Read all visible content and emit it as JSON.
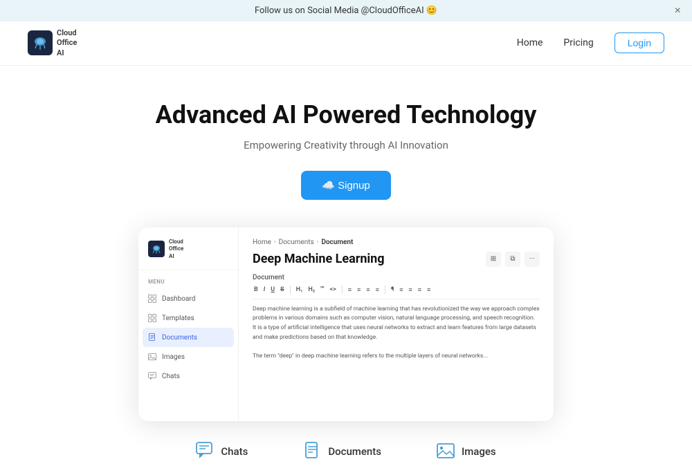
{
  "announcement": {
    "text": "Follow us on Social Media @CloudOfficeAI 😊",
    "close_label": "×"
  },
  "navbar": {
    "logo_name": "Cloud Office AI",
    "nav_home": "Home",
    "nav_pricing": "Pricing",
    "login_label": "Login"
  },
  "hero": {
    "title": "Advanced AI Powered Technology",
    "subtitle": "Empowering Creativity through AI Innovation",
    "signup_label": "☁️ Signup"
  },
  "preview": {
    "sidebar": {
      "logo": "Cloud Office AI",
      "menu_label": "MENU",
      "items": [
        {
          "label": "Dashboard",
          "active": false
        },
        {
          "label": "Templates",
          "active": false
        },
        {
          "label": "Documents",
          "active": true
        },
        {
          "label": "Images",
          "active": false
        },
        {
          "label": "Chats",
          "active": false
        }
      ]
    },
    "main": {
      "breadcrumb": [
        "Home",
        "Documents",
        "Document"
      ],
      "doc_title": "Deep Machine Learning",
      "document_label": "Document",
      "toolbar_items": [
        "B",
        "I",
        "U",
        "S",
        "H₁",
        "H₂",
        "\"\"",
        "<>",
        "≡",
        "≡",
        "≡",
        "≡",
        "¶",
        "≡",
        "≡",
        "≡",
        "≡"
      ],
      "content_para1": "Deep machine learning is a subfield of machine learning that has revolutionized the way we approach complex problems in various domains such as computer vision, natural language processing, and speech recognition. It is a type of artificial intelligence that uses neural networks to extract and learn features from large datasets and make predictions based on that knowledge.",
      "content_para2": "The term \"deep\" in deep machine learning refers to the multiple layers of neural networks..."
    }
  },
  "features": [
    {
      "label": "Chats",
      "icon": "chat"
    },
    {
      "label": "Documents",
      "icon": "doc"
    },
    {
      "label": "Images",
      "icon": "img"
    }
  ]
}
